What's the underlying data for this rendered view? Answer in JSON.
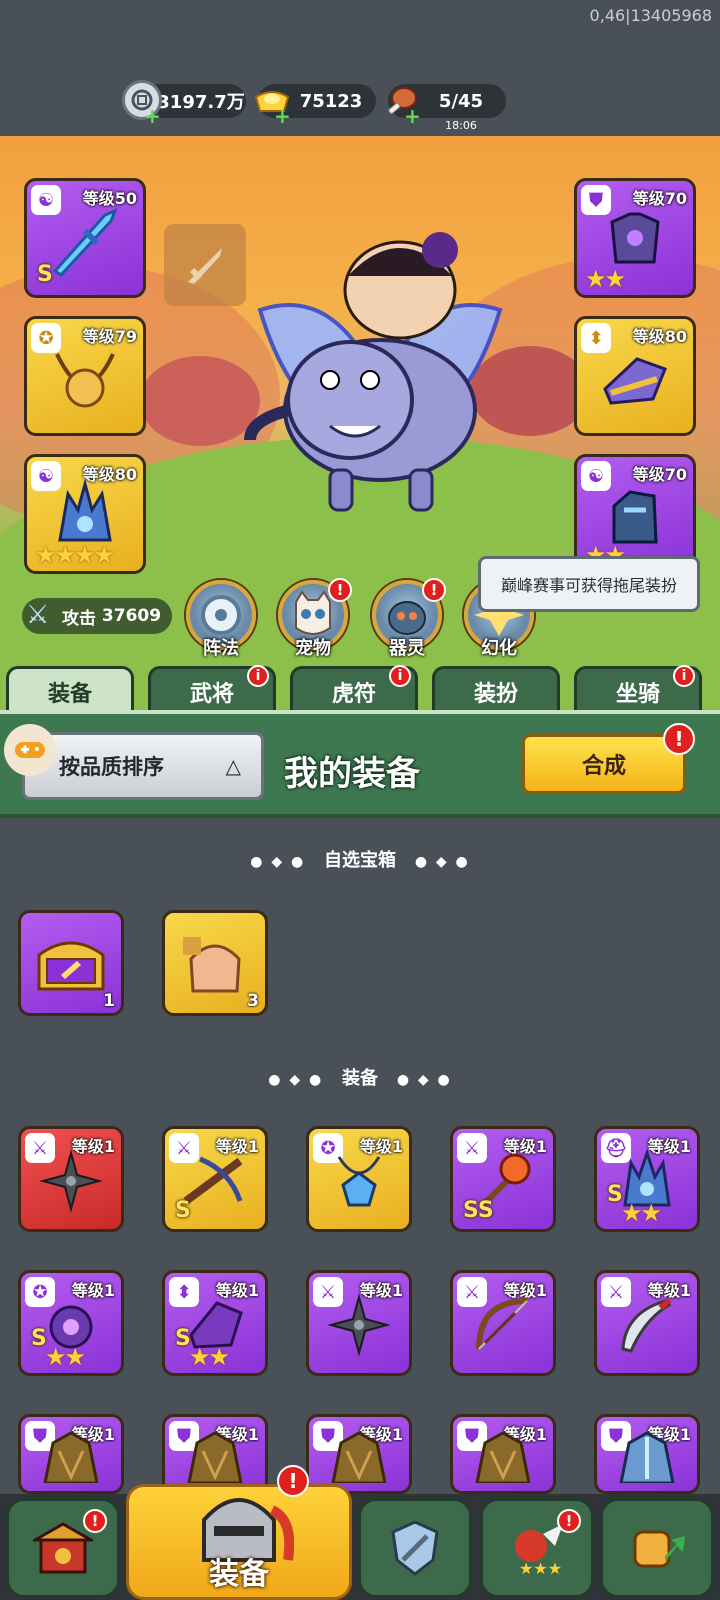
{
  "debug_text": "0,46|13405968",
  "resources": {
    "silver": {
      "value": "3197.7万",
      "icon": "silver-coin-icon"
    },
    "gold": {
      "value": "75123",
      "icon": "gold-ingot-icon"
    },
    "stamina": {
      "value": "5/45",
      "timer": "18:06",
      "icon": "meat-icon"
    }
  },
  "slots_left": [
    {
      "level": "等级50",
      "grade": "S",
      "rarity": "purple",
      "tag": "yin-yang-icon",
      "item": "blue-sword-icon"
    },
    {
      "level": "等级79",
      "grade": "",
      "rarity": "gold",
      "tag": "medal-icon",
      "item": "gold-amulet-icon"
    },
    {
      "level": "等级80",
      "grade": "",
      "rarity": "gold",
      "tag": "yin-yang-icon",
      "item": "ice-helmet-icon",
      "stars": "★★★★"
    }
  ],
  "slots_right": [
    {
      "level": "等级70",
      "grade": "",
      "rarity": "purple",
      "tag": "armor-icon",
      "item": "purple-armor-icon",
      "stars": "★★"
    },
    {
      "level": "等级80",
      "grade": "",
      "rarity": "gold",
      "tag": "boot-icon",
      "item": "gold-boot-icon"
    },
    {
      "level": "等级70",
      "grade": "",
      "rarity": "purple",
      "tag": "yin-yang-icon",
      "item": "ice-gauntlet-icon",
      "stars": "★★"
    }
  ],
  "attack": {
    "label": "攻击",
    "value": "37609"
  },
  "circle_buttons": [
    {
      "label": "阵法",
      "icon": "formation-icon",
      "alert": false
    },
    {
      "label": "宠物",
      "icon": "cat-icon",
      "alert": true
    },
    {
      "label": "器灵",
      "icon": "spirit-icon",
      "alert": true
    },
    {
      "label": "幻化",
      "icon": "transform-icon",
      "alert": false
    }
  ],
  "tooltip": "巅峰赛事可获得拖尾装扮",
  "tabs": [
    {
      "label": "装备",
      "active": true,
      "alert": false
    },
    {
      "label": "武将",
      "active": false,
      "alert": true
    },
    {
      "label": "虎符",
      "active": false,
      "alert": true
    },
    {
      "label": "装扮",
      "active": false,
      "alert": false
    },
    {
      "label": "坐骑",
      "active": false,
      "alert": true
    }
  ],
  "panel": {
    "sort_label": "按品质排序",
    "title": "我的装备",
    "merge_label": "合成",
    "alert": "!"
  },
  "sections": {
    "chests": "自选宝箱",
    "equipment": "装备"
  },
  "chests": [
    {
      "count": "1",
      "rarity": "purple",
      "icon": "chest-icon"
    },
    {
      "count": "3",
      "rarity": "gold",
      "icon": "puzzle-bag-icon"
    }
  ],
  "equipment_rows": [
    [
      {
        "level": "等级1",
        "rarity": "red",
        "grade": "",
        "stars": "",
        "icon": "shuriken-icon",
        "tag": "sword-tag-icon"
      },
      {
        "level": "等级1",
        "rarity": "gold",
        "grade": "S",
        "stars": "",
        "icon": "crossbow-icon",
        "tag": "sword-tag-icon"
      },
      {
        "level": "等级1",
        "rarity": "gold",
        "grade": "",
        "stars": "",
        "icon": "blue-amulet-icon",
        "tag": "medal-icon"
      },
      {
        "level": "等级1",
        "rarity": "purple",
        "grade": "SS",
        "stars": "",
        "icon": "dragon-staff-icon",
        "tag": "sword-tag-icon"
      },
      {
        "level": "等级1",
        "rarity": "purple",
        "grade": "S",
        "stars": "★★",
        "icon": "ice-helmet-icon",
        "tag": "helmet-tag-icon"
      }
    ],
    [
      {
        "level": "等级1",
        "rarity": "purple",
        "grade": "S",
        "stars": "★★",
        "icon": "purple-orb-amulet-icon",
        "tag": "medal-icon"
      },
      {
        "level": "等级1",
        "rarity": "purple",
        "grade": "S",
        "stars": "★★",
        "icon": "purple-boot-icon",
        "tag": "boot-icon"
      },
      {
        "level": "等级1",
        "rarity": "purple",
        "grade": "",
        "stars": "",
        "icon": "shuriken-icon",
        "tag": "sword-tag-icon"
      },
      {
        "level": "等级1",
        "rarity": "purple",
        "grade": "",
        "stars": "",
        "icon": "bow-icon",
        "tag": "sword-tag-icon"
      },
      {
        "level": "等级1",
        "rarity": "purple",
        "grade": "",
        "stars": "",
        "icon": "curved-blade-icon",
        "tag": "sword-tag-icon"
      }
    ],
    [
      {
        "level": "等级1",
        "rarity": "purple",
        "grade": "",
        "stars": "",
        "icon": "leaf-armor-icon",
        "tag": "armor-icon"
      },
      {
        "level": "等级1",
        "rarity": "purple",
        "grade": "",
        "stars": "",
        "icon": "leaf-armor-icon",
        "tag": "armor-icon"
      },
      {
        "level": "等级1",
        "rarity": "purple",
        "grade": "",
        "stars": "",
        "icon": "leaf-armor-icon",
        "tag": "armor-icon"
      },
      {
        "level": "等级1",
        "rarity": "purple",
        "grade": "",
        "stars": "",
        "icon": "leaf-armor-icon",
        "tag": "armor-icon"
      },
      {
        "level": "等级1",
        "rarity": "purple",
        "grade": "",
        "stars": "",
        "icon": "ice-armor-icon",
        "tag": "armor-icon"
      }
    ]
  ],
  "bottom_nav": [
    {
      "label": "",
      "icon": "shop-gate-icon",
      "alert": true,
      "active": false
    },
    {
      "label": "装备",
      "icon": "helmet-icon",
      "alert": true,
      "active": true
    },
    {
      "label": "",
      "icon": "arena-shield-icon",
      "alert": false,
      "active": false
    },
    {
      "label": "",
      "icon": "rooster-hero-icon",
      "alert": true,
      "active": false
    },
    {
      "label": "",
      "icon": "fist-upgrade-icon",
      "alert": false,
      "active": false
    }
  ],
  "colors": {
    "purple": "#9a44e0",
    "gold": "#f0c030",
    "red": "#e03838",
    "green_tab": "#3c6a4a",
    "alert": "#e0201c"
  }
}
